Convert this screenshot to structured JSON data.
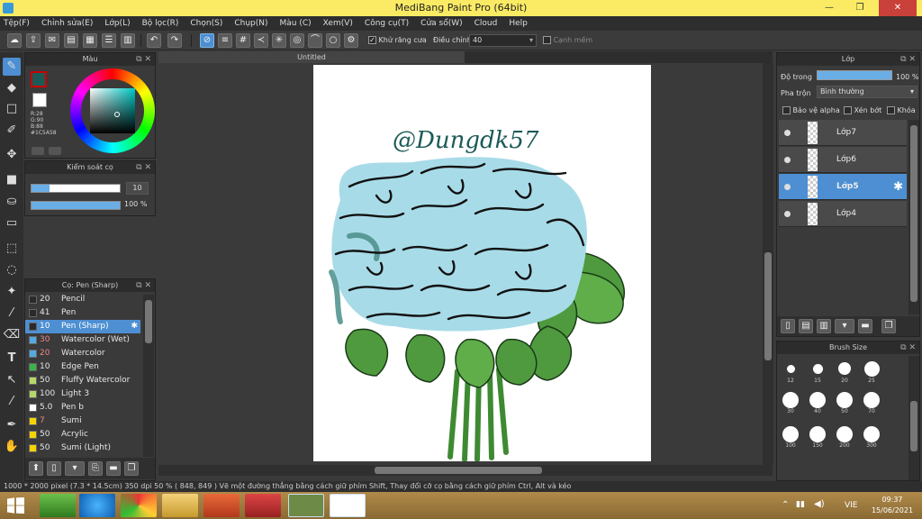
{
  "window": {
    "title": "MediBang Paint Pro (64bit)",
    "minimize": "—",
    "restore": "❐",
    "close": "✕"
  },
  "menu": [
    "Tệp(F)",
    "Chỉnh sửa(E)",
    "Lớp(L)",
    "Bộ lọc(R)",
    "Chọn(S)",
    "Chụp(N)",
    "Màu (C)",
    "Xem(V)",
    "Công cụ(T)",
    "Cửa sổ(W)",
    "Cloud",
    "Help"
  ],
  "toolbar": {
    "antialias_label": "Khử răng cưa",
    "adjust_label": "Điều chỉnh",
    "adjust_value": "40",
    "strong_edge_label": "Cạnh mềm"
  },
  "color_panel": {
    "title": "Màu",
    "r": "R:28",
    "g": "G:90",
    "b": "B:88",
    "hex": "#1C5A58",
    "fg_color": "#1C5A58",
    "bg_color": "#ffffff"
  },
  "brush_control": {
    "title": "Kiểm soát cọ",
    "size_value": "10",
    "opacity_value": "100 %"
  },
  "brush_panel": {
    "title": "Cọ: Pen (Sharp)",
    "items": [
      {
        "size": "20",
        "name": "Pencil",
        "color": "#2a2a2a"
      },
      {
        "size": "41",
        "name": "Pen",
        "color": "#2a2a2a"
      },
      {
        "size": "10",
        "name": "Pen (Sharp)",
        "color": "#2a2a2a",
        "selected": true
      },
      {
        "size": "30",
        "name": "Watercolor (Wet)",
        "color": "#54a9e0"
      },
      {
        "size": "20",
        "name": "Watercolor",
        "color": "#54a9e0"
      },
      {
        "size": "10",
        "name": "Edge Pen",
        "color": "#3bb34a"
      },
      {
        "size": "50",
        "name": "Fluffy Watercolor",
        "color": "#b4d96a"
      },
      {
        "size": "100",
        "name": "Light 3",
        "color": "#b4d96a"
      },
      {
        "size": "5.0",
        "name": " Pen b",
        "color": "#ffffff"
      },
      {
        "size": "7",
        "name": "Sumi",
        "color": "#f5d400"
      },
      {
        "size": "50",
        "name": "Acrylic",
        "color": "#f5d400"
      },
      {
        "size": "50",
        "name": "Sumi (Light)",
        "color": "#f5d400"
      }
    ]
  },
  "canvas": {
    "tab_title": "Untitled",
    "signature": "@Dungdk57"
  },
  "layers_panel": {
    "title": "Lớp",
    "opacity_label": "Độ trong",
    "opacity_value": "100 %",
    "blend_label": "Pha trộn",
    "blend_value": "Bình thường",
    "protect_alpha": "Bảo vệ alpha",
    "clipping": "Xén bớt",
    "lock": "Khóa",
    "layers": [
      {
        "name": "Lớp7"
      },
      {
        "name": "Lớp6"
      },
      {
        "name": "Lớp5",
        "selected": true
      },
      {
        "name": "Lớp4"
      }
    ]
  },
  "brush_size_panel": {
    "title": "Brush Size",
    "sizes": [
      "12",
      "15",
      "20",
      "25",
      "30",
      "40",
      "50",
      "70",
      "100",
      "150",
      "200",
      "300"
    ]
  },
  "status": {
    "text": "1000 * 2000 pixel   (7.3 * 14.5cm)  350 dpi   50 %   ( 848, 849 )  Vẽ một đường thẳng bằng cách giữ phím Shift, Thay đổi cỡ cọ bằng cách giữ phím Ctrl, Alt và kéo"
  },
  "taskbar": {
    "lang": "VIE",
    "time": "09:37",
    "date": "15/06/2021"
  }
}
